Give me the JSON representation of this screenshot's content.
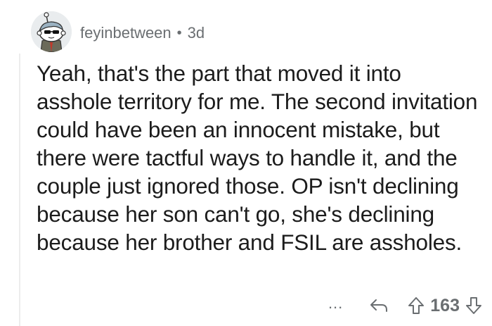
{
  "comment": {
    "username": "feyinbetween",
    "separator": "•",
    "age": "3d",
    "body": "Yeah, that's the part that moved it into asshole territory for me. The second invitation could have been an innocent mistake, but there were tactful ways to handle it, and the couple just ignored those. OP isn't declining because her son can't go, she's declining because her brother and FSIL are assholes."
  },
  "actions": {
    "more_label": "...",
    "score": "163",
    "icons": {
      "reply": "reply-arrow-icon",
      "upvote": "upvote-arrow-icon",
      "downvote": "downvote-arrow-icon"
    }
  },
  "colors": {
    "meta_text": "#6a6e71",
    "body_text": "#1c1c1c",
    "thread_line": "#ececec"
  }
}
